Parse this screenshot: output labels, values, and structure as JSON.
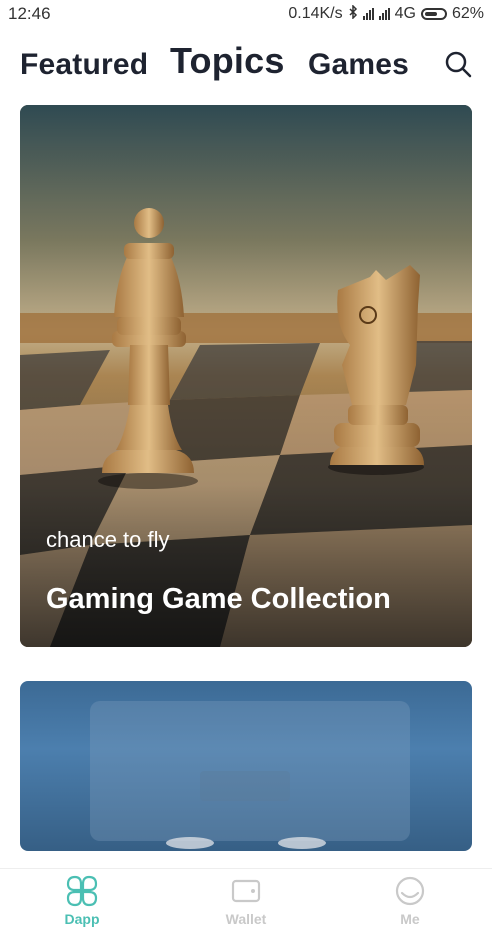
{
  "status_bar": {
    "time": "12:46",
    "network_speed": "0.14K/s",
    "network_type": "4G",
    "battery": "62%"
  },
  "top_tabs": [
    {
      "label": "Featured",
      "active": false
    },
    {
      "label": "Topics",
      "active": true
    },
    {
      "label": "Games",
      "active": false
    }
  ],
  "cards": [
    {
      "subtitle": "chance to fly",
      "title": "Gaming Game Collection",
      "image": "chess-pieces-on-board"
    },
    {
      "subtitle": "",
      "title": "",
      "image": "blue-device-photo"
    }
  ],
  "bottom_nav": [
    {
      "label": "Dapp",
      "icon": "dapp-grid-icon",
      "active": true
    },
    {
      "label": "Wallet",
      "icon": "wallet-icon",
      "active": false
    },
    {
      "label": "Me",
      "icon": "profile-icon",
      "active": false
    }
  ],
  "colors": {
    "accent": "#4bbfb3",
    "inactive": "#c9c9c9",
    "tab_text": "#1e2330"
  }
}
